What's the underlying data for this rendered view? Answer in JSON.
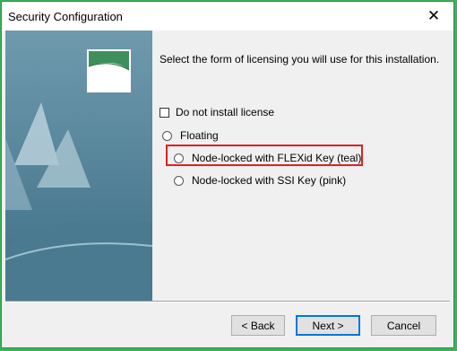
{
  "window": {
    "title": "Security Configuration"
  },
  "content": {
    "instruction": "Select the form of licensing you will use for this installation.",
    "checkbox_label": "Do not install license",
    "options": [
      {
        "label": "Floating"
      },
      {
        "label": "Node-locked with FLEXid Key (teal)"
      },
      {
        "label": "Node-locked with SSI Key (pink)"
      }
    ]
  },
  "buttons": {
    "back": "< Back",
    "next": "Next >",
    "cancel": "Cancel"
  },
  "colors": {
    "highlight": "#e02020",
    "art_background": "#54849a",
    "logo_green": "#3f8f5a"
  }
}
